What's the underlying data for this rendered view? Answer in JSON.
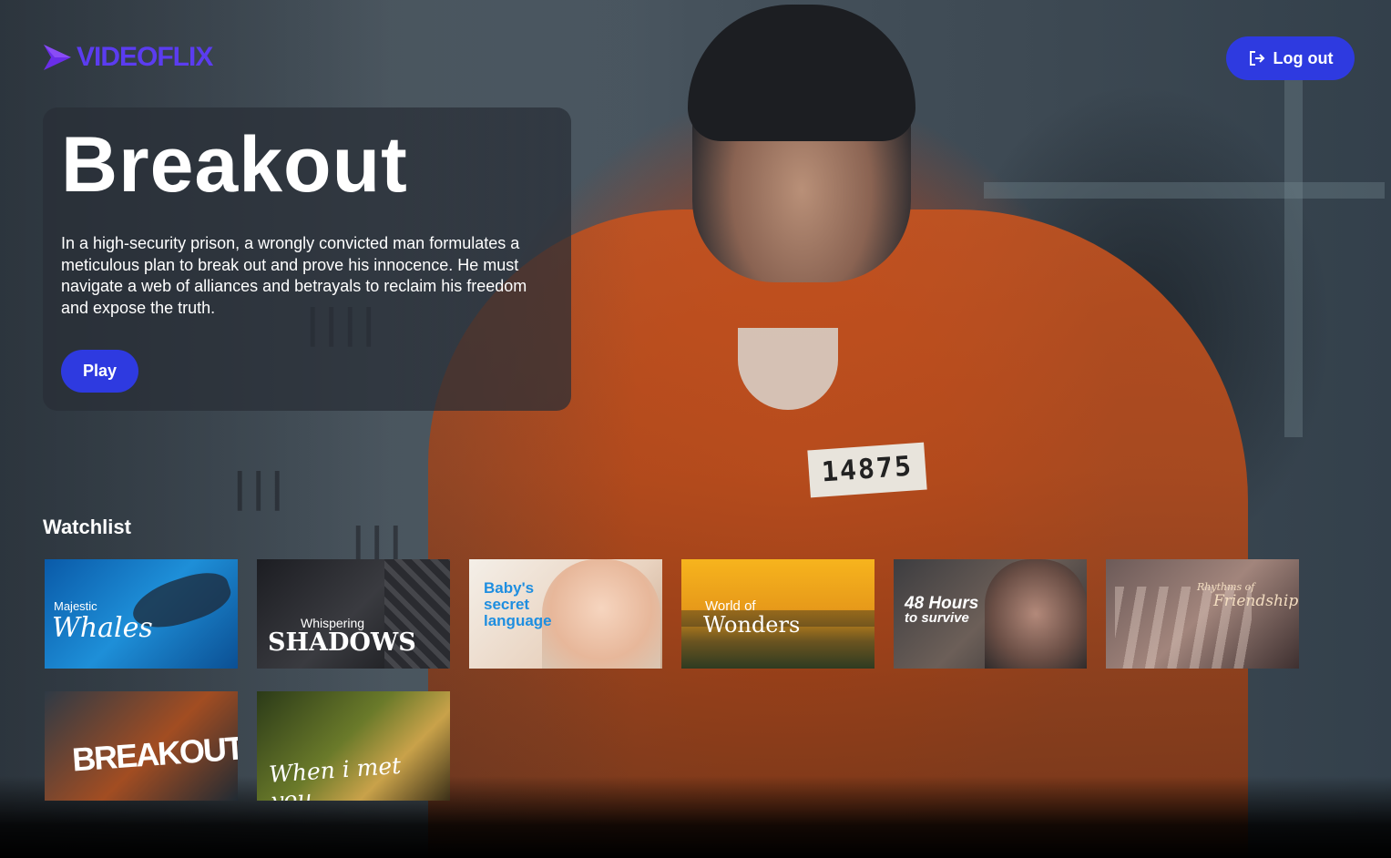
{
  "brand": {
    "name": "VIDEOFLIX",
    "accent_color": "#5b3cf0"
  },
  "header": {
    "logout_label": "Log out",
    "logout_icon": "logout-icon",
    "button_color": "#2e3ae0"
  },
  "hero": {
    "title": "Breakout",
    "description": "In a high-security prison, a wrongly convicted man formulates a meticulous plan to break out and prove his innocence. He must navigate a web of alliances and betrayals to reclaim his freedom and expose the truth.",
    "play_label": "Play",
    "badge_number": "14875"
  },
  "watchlist": {
    "heading": "Watchlist",
    "items": [
      {
        "line1": "Majestic",
        "line2": "Whales"
      },
      {
        "line1": "Whispering",
        "line2": "SHADOWS"
      },
      {
        "line1": "Baby's",
        "line2": "secret",
        "line3": "language"
      },
      {
        "line1": "World of",
        "line2": "Wonders"
      },
      {
        "line1": "48 Hours",
        "line2": "to survive"
      },
      {
        "line1": "Rhythms of",
        "line2": "Friendship"
      },
      {
        "line1": "BREAKOUT"
      },
      {
        "line1": "When i met you"
      }
    ]
  }
}
